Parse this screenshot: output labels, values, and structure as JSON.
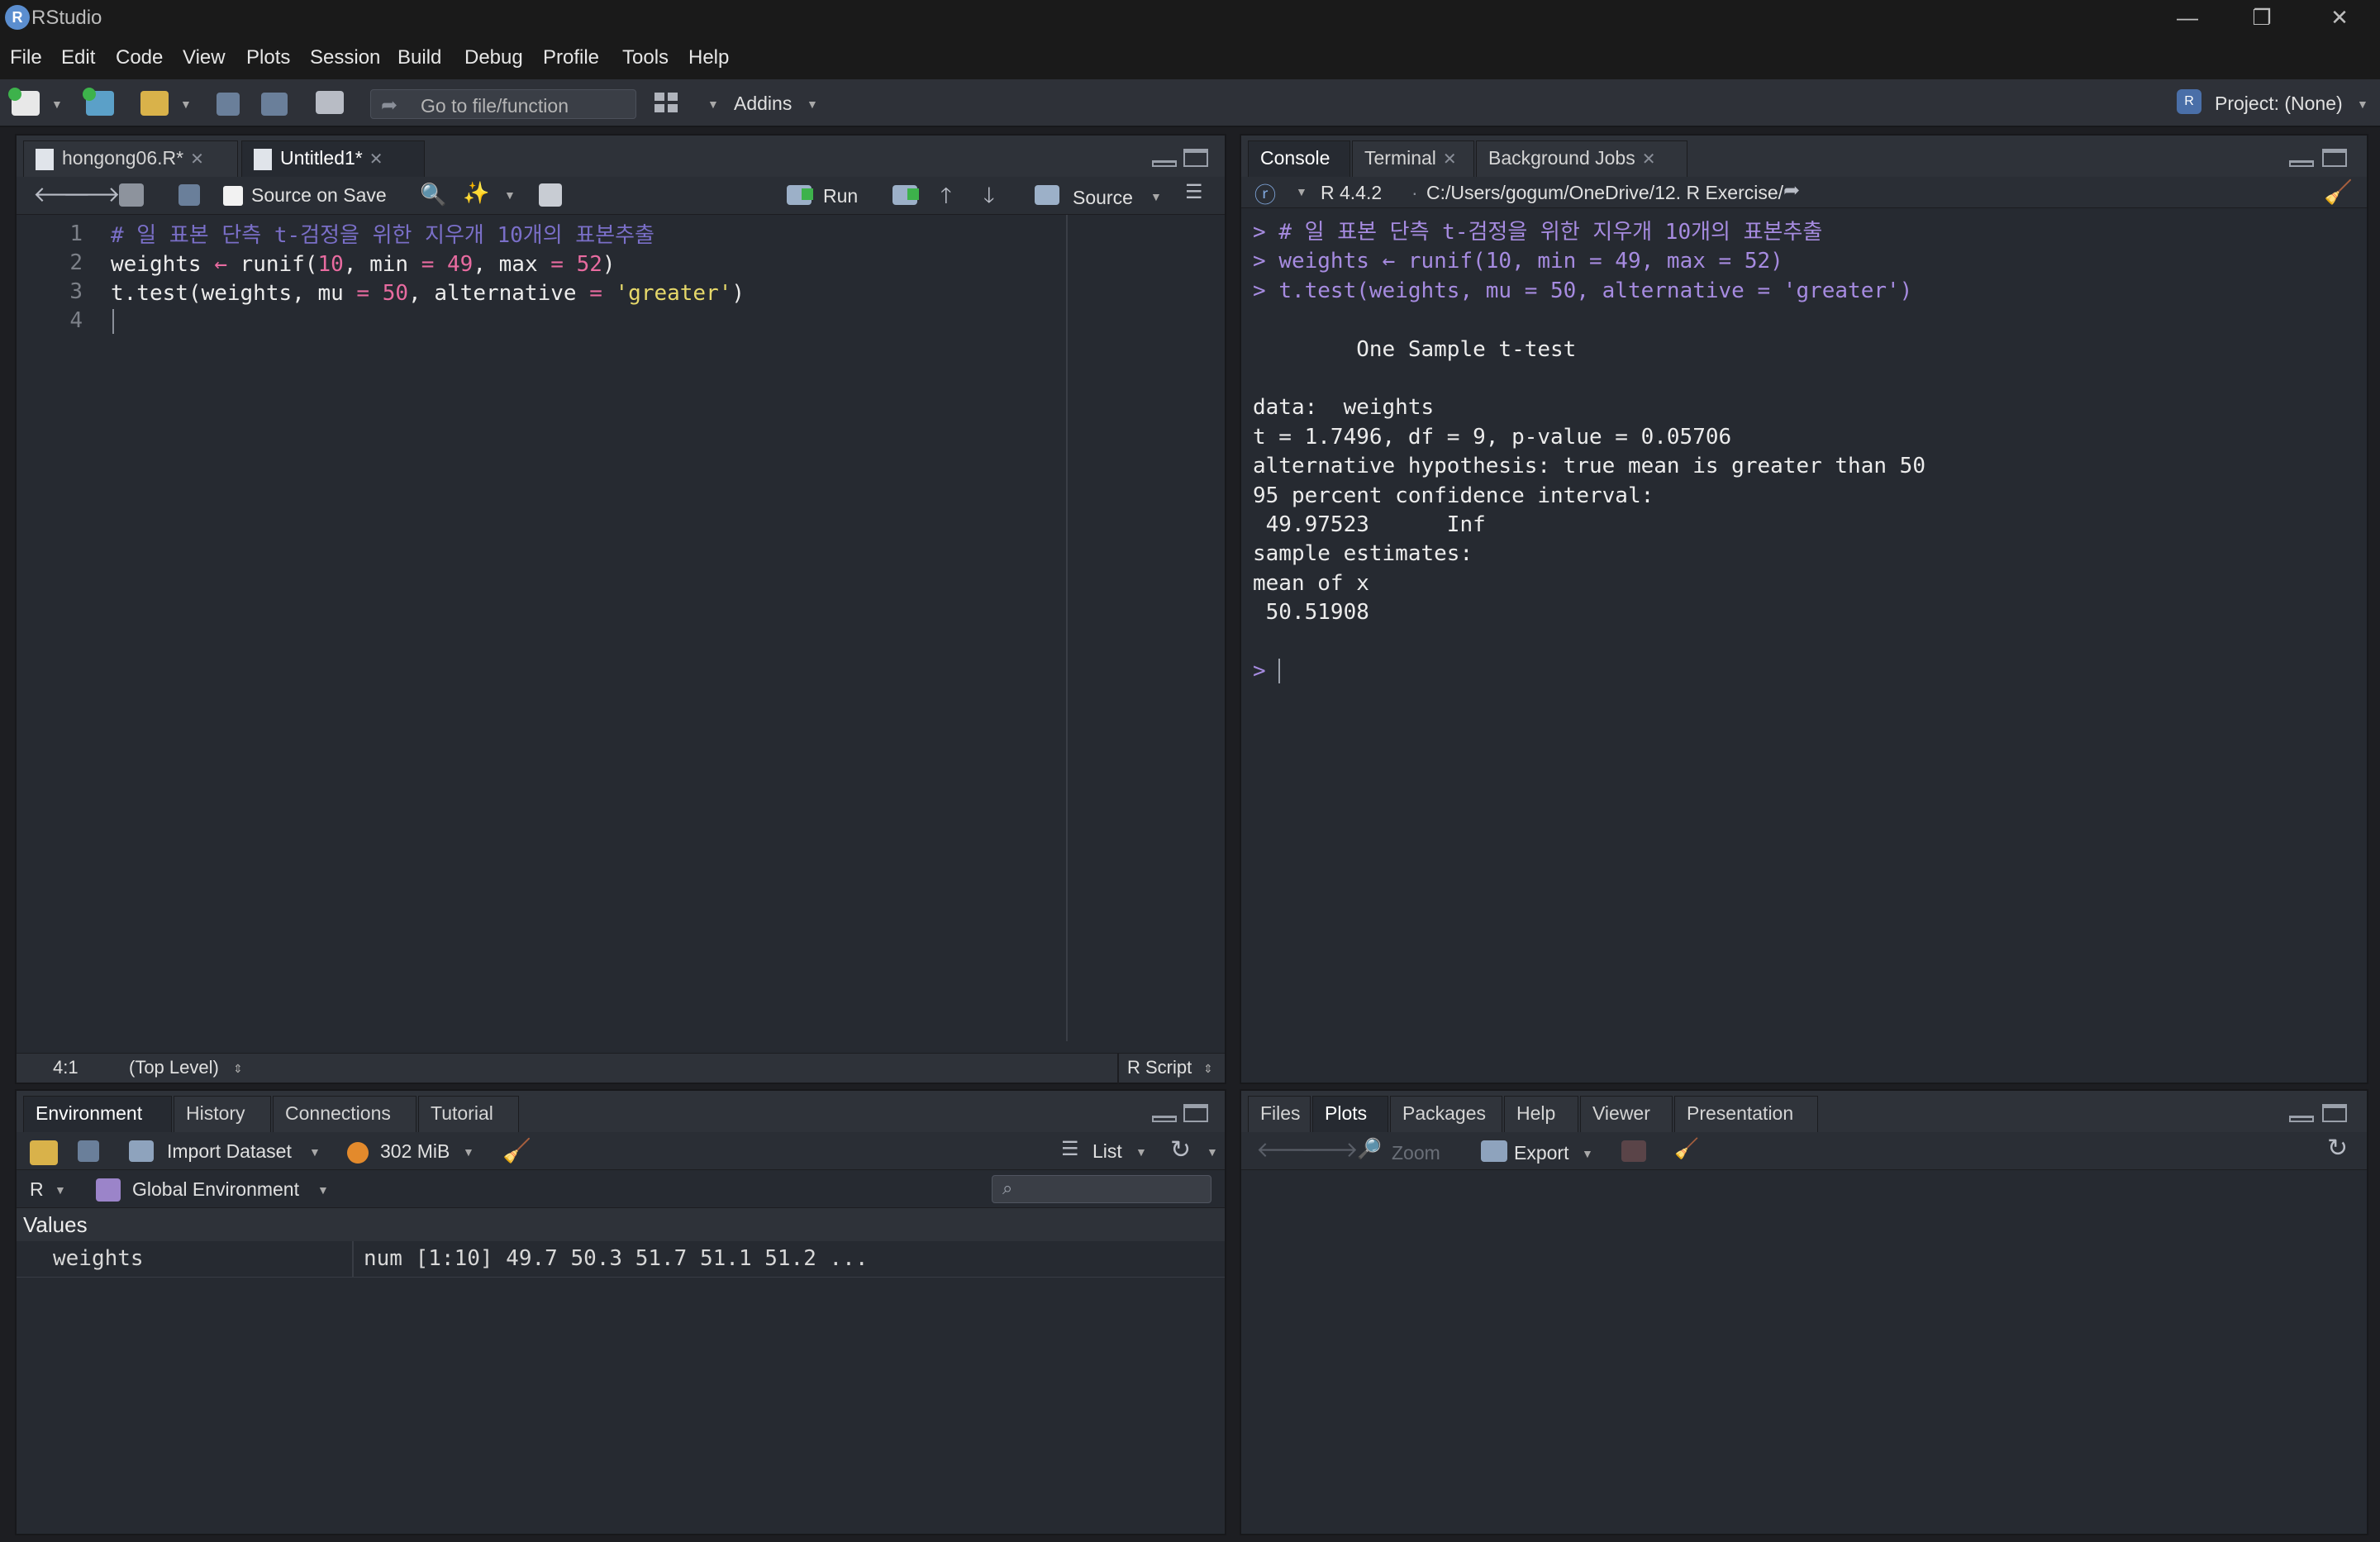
{
  "app": {
    "title": "RStudio",
    "logo_letter": "R"
  },
  "window_controls": {
    "minimize": "—",
    "restore": "❐",
    "close": "✕"
  },
  "menu": [
    "File",
    "Edit",
    "Code",
    "View",
    "Plots",
    "Session",
    "Build",
    "Debug",
    "Profile",
    "Tools",
    "Help"
  ],
  "toolbar": {
    "goto_placeholder": "Go to file/function",
    "addins_label": "Addins",
    "project_label": "Project: (None)"
  },
  "editor": {
    "tabs": [
      {
        "label": "hongong06.R*",
        "active": false
      },
      {
        "label": "Untitled1*",
        "active": true
      }
    ],
    "source_on_save_label": "Source on Save",
    "run_label": "Run",
    "source_label": "Source",
    "line_numbers": [
      "1",
      "2",
      "3",
      "4"
    ],
    "code": [
      {
        "t": "cm",
        "v": "# 일 표본 단측 t-검정을 위한 지우개 10개의 표본추출"
      },
      [
        {
          "t": "fn",
          "v": "weights "
        },
        {
          "t": "op",
          "v": "←"
        },
        {
          "t": "fn",
          "v": " runif("
        },
        {
          "t": "num",
          "v": "10"
        },
        {
          "t": "fn",
          "v": ", min "
        },
        {
          "t": "op",
          "v": "="
        },
        {
          "t": "fn",
          "v": " "
        },
        {
          "t": "num",
          "v": "49"
        },
        {
          "t": "fn",
          "v": ", max "
        },
        {
          "t": "op",
          "v": "="
        },
        {
          "t": "fn",
          "v": " "
        },
        {
          "t": "num",
          "v": "52"
        },
        {
          "t": "fn",
          "v": ")"
        }
      ],
      [
        {
          "t": "fn",
          "v": "t.test(weights, mu "
        },
        {
          "t": "op",
          "v": "="
        },
        {
          "t": "fn",
          "v": " "
        },
        {
          "t": "num",
          "v": "50"
        },
        {
          "t": "fn",
          "v": ", alternative "
        },
        {
          "t": "op",
          "v": "="
        },
        {
          "t": "fn",
          "v": " "
        },
        {
          "t": "str",
          "v": "'greater'"
        },
        {
          "t": "fn",
          "v": ")"
        }
      ],
      {
        "t": "fn",
        "v": ""
      }
    ],
    "status": {
      "position": "4:1",
      "scope": "(Top Level)",
      "filetype": "R Script"
    }
  },
  "console": {
    "tabs": [
      {
        "label": "Console",
        "active": true,
        "closable": false
      },
      {
        "label": "Terminal",
        "active": false,
        "closable": true
      },
      {
        "label": "Background Jobs",
        "active": false,
        "closable": true
      }
    ],
    "r_version": "R 4.4.2",
    "path": "C:/Users/gogum/OneDrive/12. R Exercise/",
    "input_lines": [
      "# 일 표본 단측 t-검정을 위한 지우개 10개의 표본추출",
      "weights ← runif(10, min = 49, max = 52)",
      "t.test(weights, mu = 50, alternative = 'greater')"
    ],
    "output_lines": [
      "",
      "\tOne Sample t-test",
      "",
      "data:  weights",
      "t = 1.7496, df = 9, p-value = 0.05706",
      "alternative hypothesis: true mean is greater than 50",
      "95 percent confidence interval:",
      " 49.97523      Inf",
      "sample estimates:",
      "mean of x ",
      " 50.51908 ",
      ""
    ],
    "prompt": ">"
  },
  "environment": {
    "tabs": [
      {
        "label": "Environment",
        "active": true
      },
      {
        "label": "History",
        "active": false
      },
      {
        "label": "Connections",
        "active": false
      },
      {
        "label": "Tutorial",
        "active": false
      }
    ],
    "import_label": "Import Dataset",
    "memory_label": "302 MiB",
    "view_label": "List",
    "lang_label": "R",
    "scope_label": "Global Environment",
    "section": "Values",
    "rows": [
      {
        "name": "weights",
        "value": "num [1:10] 49.7 50.3 51.7 51.1 51.2 ..."
      }
    ]
  },
  "files": {
    "tabs": [
      {
        "label": "Files",
        "active": false
      },
      {
        "label": "Plots",
        "active": true
      },
      {
        "label": "Packages",
        "active": false
      },
      {
        "label": "Help",
        "active": false
      },
      {
        "label": "Viewer",
        "active": false
      },
      {
        "label": "Presentation",
        "active": false
      }
    ],
    "zoom_label": "Zoom",
    "export_label": "Export"
  }
}
